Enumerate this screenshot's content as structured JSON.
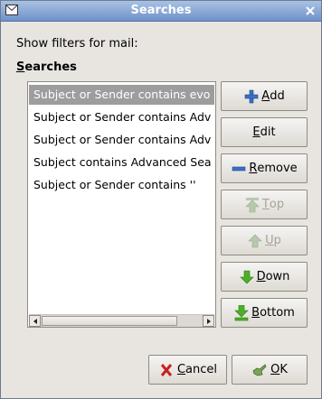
{
  "window": {
    "title": "Searches"
  },
  "intro_label": "Show filters for mail:",
  "heading": {
    "mnemonic": "S",
    "rest": "earches"
  },
  "searches": [
    "Subject or Sender contains evo",
    "Subject or Sender contains Adv",
    "Subject or Sender contains Adv",
    "Subject contains Advanced Sea",
    "Subject or Sender contains ''"
  ],
  "selected_index": 0,
  "buttons": {
    "add": {
      "mnemonic": "A",
      "rest": "dd"
    },
    "edit": {
      "mnemonic": "E",
      "rest": "dit"
    },
    "remove": {
      "mnemonic": "R",
      "rest": "emove"
    },
    "top": {
      "mnemonic": "T",
      "rest": "op"
    },
    "up": {
      "mnemonic": "U",
      "rest": "p"
    },
    "down": {
      "mnemonic": "D",
      "rest": "own"
    },
    "bottom": {
      "mnemonic": "B",
      "rest": "ottom"
    }
  },
  "dialog_buttons": {
    "cancel": {
      "mnemonic": "C",
      "rest": "ancel"
    },
    "ok": {
      "mnemonic": "O",
      "rest": "K"
    }
  },
  "icons": {
    "title": "mail-envelope-icon",
    "add": "plus-icon",
    "remove": "minus-icon",
    "top": "arrow-top-icon",
    "up": "arrow-up-icon",
    "down": "arrow-down-icon",
    "bottom": "arrow-bottom-icon",
    "cancel": "cancel-x-icon",
    "ok": "ok-hand-icon"
  },
  "colors": {
    "titlebar": "#6f91c9",
    "selection": "#9d9d9d",
    "arrow_green": "#4caf28",
    "cancel_red": "#c9211e",
    "plus_blue": "#3a6fc4"
  }
}
